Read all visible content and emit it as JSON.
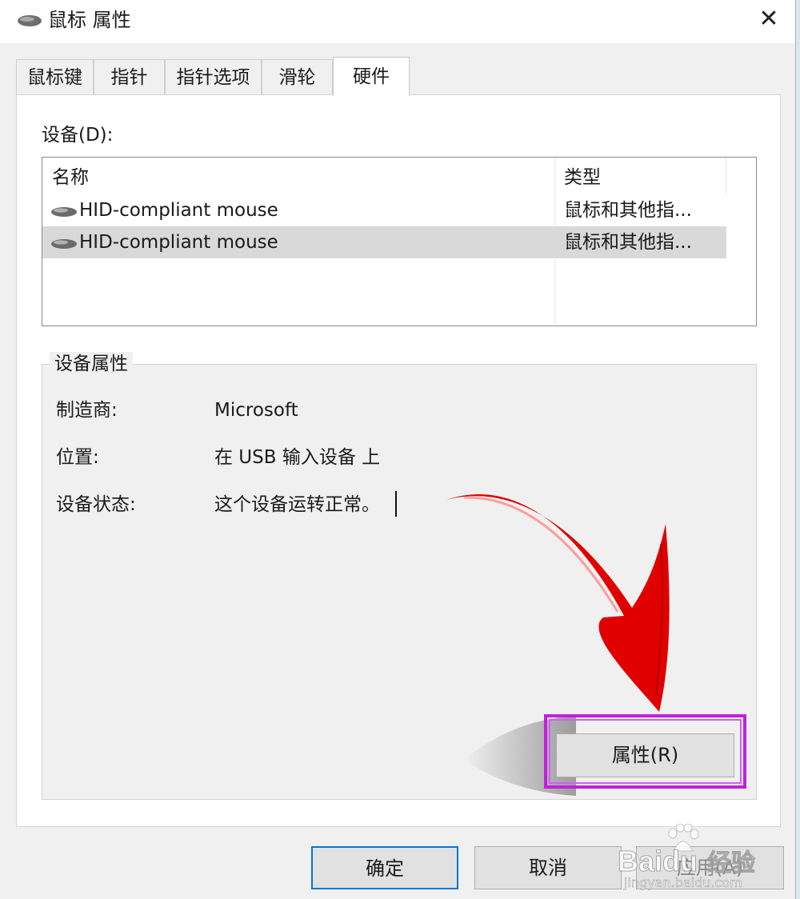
{
  "window": {
    "title": "鼠标 属性",
    "close_glyph": "✕"
  },
  "tabs": [
    {
      "label": "鼠标键",
      "active": false
    },
    {
      "label": "指针",
      "active": false
    },
    {
      "label": "指针选项",
      "active": false
    },
    {
      "label": "滑轮",
      "active": false
    },
    {
      "label": "硬件",
      "active": true
    }
  ],
  "devices": {
    "label": "设备(D):",
    "columns": {
      "name": "名称",
      "type": "类型"
    },
    "rows": [
      {
        "icon": "mouse-icon",
        "name": "HID-compliant mouse",
        "type": "鼠标和其他指...",
        "selected": false
      },
      {
        "icon": "mouse-icon",
        "name": "HID-compliant mouse",
        "type": "鼠标和其他指...",
        "selected": true
      }
    ]
  },
  "device_properties": {
    "title": "设备属性",
    "manufacturer_label": "制造商:",
    "manufacturer_value": "Microsoft",
    "location_label": "位置:",
    "location_value": "在 USB 输入设备 上",
    "status_label": "设备状态:",
    "status_value": "这个设备运转正常。"
  },
  "properties_button": "属性(R)",
  "footer": {
    "ok": "确定",
    "cancel": "取消",
    "apply": "应用(A)"
  },
  "watermark": {
    "brand": "Baidu",
    "sub": "经验",
    "url": "jingyan.baidu.com"
  },
  "colors": {
    "highlight_outline": "#c020e0",
    "arrow": "#e00000",
    "selected_row": "#d9d9d9",
    "default_button_border": "#0078d7"
  }
}
